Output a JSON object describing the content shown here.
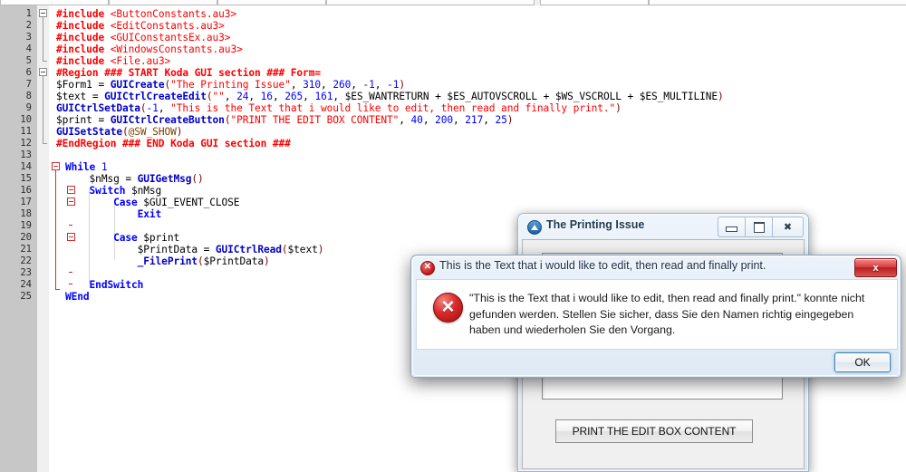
{
  "editor": {
    "language": "AutoIt",
    "line_numbers": [
      1,
      2,
      3,
      4,
      5,
      6,
      7,
      8,
      9,
      10,
      11,
      12,
      13,
      14,
      15,
      16,
      17,
      18,
      19,
      20,
      21,
      22,
      23,
      24,
      25
    ],
    "lines": [
      "#include <ButtonConstants.au3>",
      "#include <EditConstants.au3>",
      "#include <GUIConstantsEx.au3>",
      "#include <WindowsConstants.au3>",
      "#include <File.au3>",
      "#Region ### START Koda GUI section ### Form=",
      "$Form1 = GUICreate(\"The Printing Issue\", 310, 260, -1, -1)",
      "$text = GUICtrlCreateEdit(\"\", 24, 16, 265, 161, $ES_WANTRETURN + $ES_AUTOVSCROLL + $WS_VSCROLL + $ES_MULTILINE)",
      "GUICtrlSetData(-1, \"This is the Text that i would like to edit, then read and finally print.\")",
      "$print = GUICtrlCreateButton(\"PRINT THE EDIT BOX CONTENT\", 40, 200, 217, 25)",
      "GUISetState(@SW_SHOW)",
      "#EndRegion ### END Koda GUI section ###",
      "",
      "While 1",
      "    $nMsg = GUIGetMsg()",
      "    Switch $nMsg",
      "        Case $GUI_EVENT_CLOSE",
      "            Exit",
      "",
      "        Case $print",
      "            $PrintData = GUICtrlRead($text)",
      "            _FilePrint($PrintData)",
      "",
      "    EndSwitch",
      "WEnd"
    ]
  },
  "printing_window": {
    "title": "The Printing Issue",
    "icon": "autoit-app-icon",
    "minimize_label": "minimize-icon",
    "maximize_label": "maximize-icon",
    "close_label": "close-icon",
    "edit_value": "",
    "print_button_label": "PRINT THE EDIT BOX CONTENT"
  },
  "error_dialog": {
    "title": "This is the Text that i would like to edit, then read and finally print.",
    "title_icon": "error-icon",
    "close_glyph": "x",
    "message": "\"This is the Text that i would like to edit, then read and finally print.\" konnte nicht gefunden werden. Stellen Sie sicher, dass Sie den Namen richtig eingegeben haben und wiederholen Sie den Vorgang.",
    "ok_label": "OK"
  },
  "colors": {
    "keyword": "#0000ff",
    "string": "#ff0000",
    "preprocessor": "#ff0000",
    "gutter": "#c7c7c7",
    "error_red": "#c01818",
    "accent_blue": "#3c7fb1"
  }
}
